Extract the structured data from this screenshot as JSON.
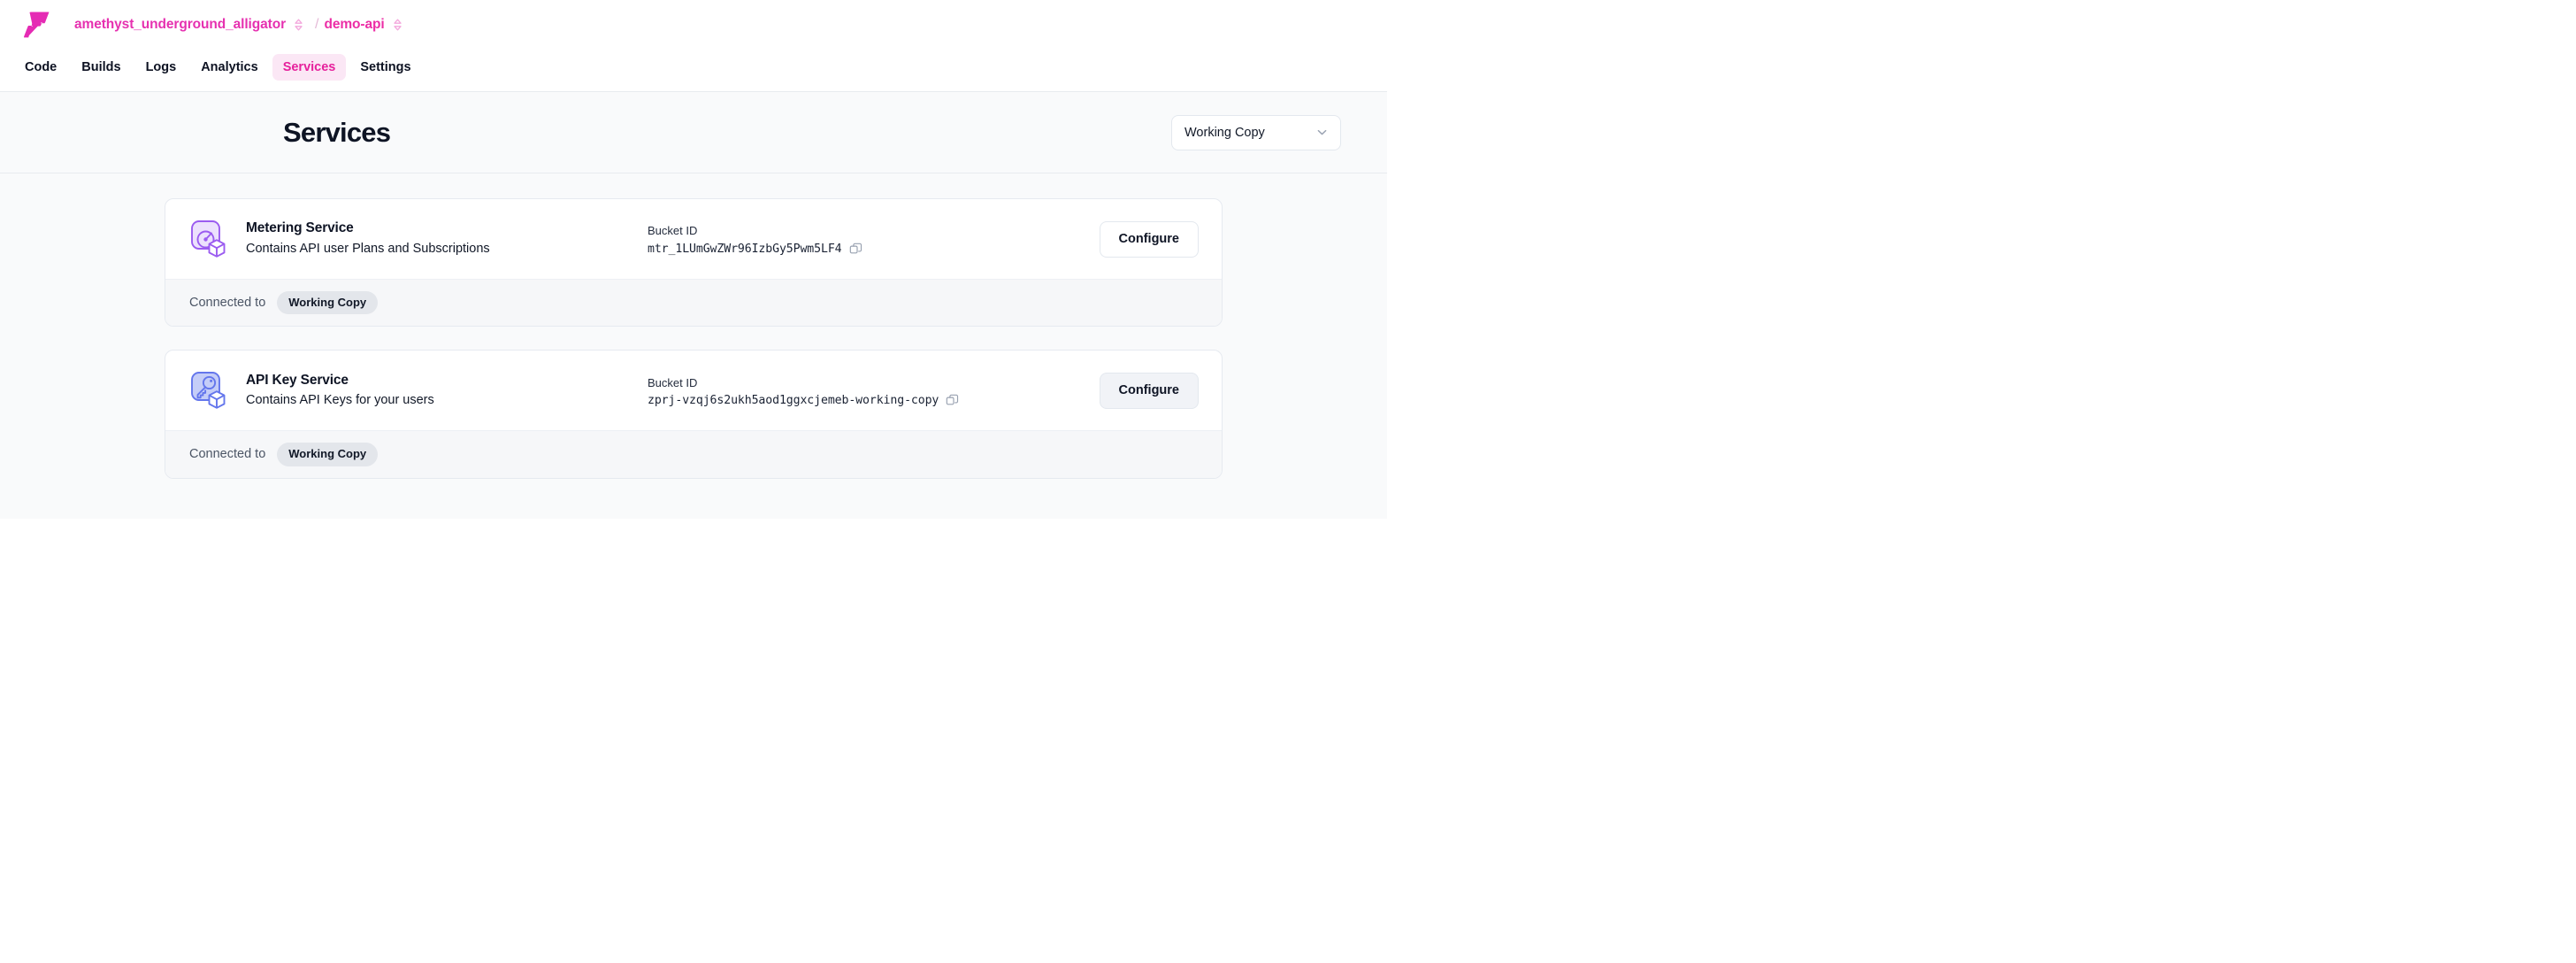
{
  "brand": {
    "logo_icon": "z-logo-icon"
  },
  "breadcrumb": {
    "org": "amethyst_underground_alligator",
    "separator": "/",
    "project": "demo-api",
    "selector_icon": "chevron-up-down-icon"
  },
  "nav": {
    "tabs": [
      {
        "label": "Code",
        "active": false
      },
      {
        "label": "Builds",
        "active": false
      },
      {
        "label": "Logs",
        "active": false
      },
      {
        "label": "Analytics",
        "active": false
      },
      {
        "label": "Services",
        "active": true
      },
      {
        "label": "Settings",
        "active": false
      }
    ]
  },
  "page": {
    "title": "Services",
    "environment_select": {
      "value": "Working Copy",
      "icon": "chevron-down-icon"
    }
  },
  "services": [
    {
      "name": "Metering Service",
      "description": "Contains API user Plans and Subscriptions",
      "icon": "gauge-cube-icon",
      "icon_color": "#9b5cf0",
      "icon_bg": "#ece1fd",
      "bucket_label": "Bucket ID",
      "bucket_id": "mtr_1LUmGwZWr96IzbGy5Pwm5LF4",
      "copy_icon": "copy-icon",
      "configure_label": "Configure",
      "configure_hovered": false,
      "connected_label": "Connected to",
      "connected_value": "Working Copy"
    },
    {
      "name": "API Key Service",
      "description": "Contains API Keys for your users",
      "icon": "key-cube-icon",
      "icon_color": "#6476ec",
      "icon_bg": "#c5cdf8",
      "bucket_label": "Bucket ID",
      "bucket_id": "zprj-vzqj6s2ukh5aod1ggxcjemeb-working-copy",
      "copy_icon": "copy-icon",
      "configure_label": "Configure",
      "configure_hovered": true,
      "connected_label": "Connected to",
      "connected_value": "Working Copy"
    }
  ],
  "colors": {
    "brand_pink": "#ec2ea6",
    "active_tab_bg": "#fbe7f5",
    "page_bg": "#f9fafb",
    "card_bg": "#ffffff",
    "card_border": "#e6eaf0",
    "footer_bg": "#f6f7f9",
    "badge_bg": "#e3e6eb"
  }
}
